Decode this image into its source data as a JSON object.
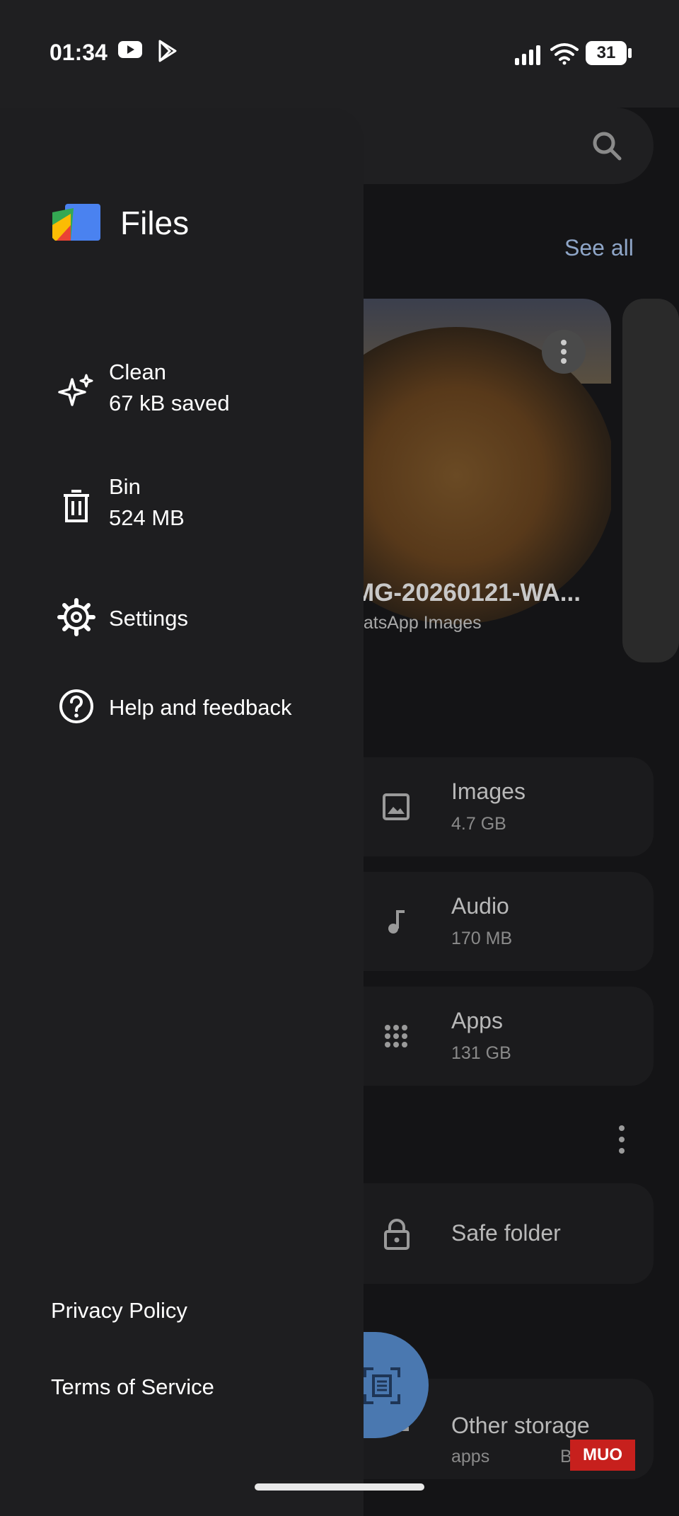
{
  "status": {
    "time": "01:34",
    "battery": "31"
  },
  "background": {
    "see_all": "See all",
    "photo": {
      "name": "MG-20260121-WA...",
      "folder": "hatsApp Images"
    },
    "categories": [
      {
        "title": "Images",
        "size": "4.7 GB",
        "icon": "image-icon"
      },
      {
        "title": "Audio",
        "size": "170 MB",
        "icon": "music-note-icon"
      },
      {
        "title": "Apps",
        "size": "131 GB",
        "icon": "apps-grid-icon"
      }
    ],
    "safe_folder": "Safe folder",
    "other_storage": {
      "title": "Other storage",
      "sub": "apps",
      "sub2": "Brows"
    }
  },
  "drawer": {
    "brand": "Files",
    "items": [
      {
        "title": "Clean",
        "sub": "67 kB saved",
        "icon": "sparkle-icon"
      },
      {
        "title": "Bin",
        "sub": "524 MB",
        "icon": "trash-icon"
      },
      {
        "title": "Settings",
        "icon": "gear-icon"
      },
      {
        "title": "Help and feedback",
        "icon": "help-icon"
      }
    ],
    "footer": {
      "privacy": "Privacy Policy",
      "terms": "Terms of Service"
    }
  },
  "watermark": "MUO"
}
